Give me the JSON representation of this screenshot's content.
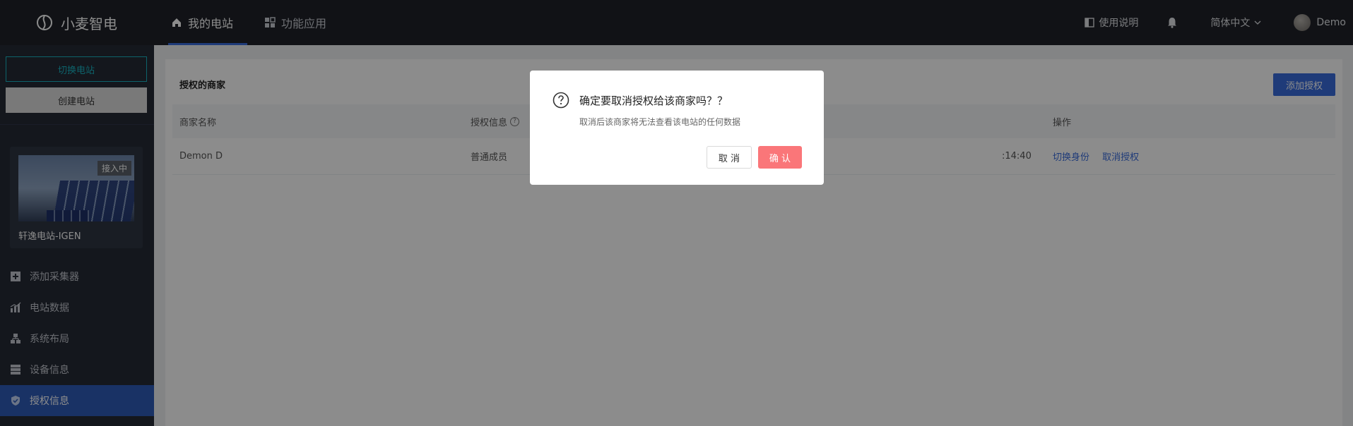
{
  "app": {
    "brand": "小麦智电",
    "colors": {
      "accent": "#3a6cdc",
      "danger": "#fa7679",
      "teal": "#19b4c4",
      "sidebar_bg": "#262b36",
      "topbar_bg": "#1f2229"
    }
  },
  "topnav": {
    "items": [
      {
        "label": "我的电站",
        "icon": "home-icon",
        "active": true
      },
      {
        "label": "功能应用",
        "icon": "apps-icon",
        "active": false
      }
    ],
    "manual": "使用说明",
    "language": "简体中文",
    "user": "Demo"
  },
  "sidebar": {
    "switch_station": "切换电站",
    "create_station": "创建电站",
    "station": {
      "status": "接入中",
      "name": "轩逸电站-IGEN"
    },
    "menu": [
      {
        "label": "添加采集器",
        "icon": "plus-square-icon",
        "active": false
      },
      {
        "label": "电站数据",
        "icon": "bar-chart-icon",
        "active": false
      },
      {
        "label": "系统布局",
        "icon": "layout-icon",
        "active": false
      },
      {
        "label": "设备信息",
        "icon": "server-icon",
        "active": false
      },
      {
        "label": "授权信息",
        "icon": "shield-icon",
        "active": true
      }
    ]
  },
  "main": {
    "title": "授权的商家",
    "add_button": "添加授权",
    "columns": [
      "商家名称",
      "授权信息",
      "",
      "操作"
    ],
    "rows": [
      {
        "merchant": "Demon D",
        "auth": "普通成员",
        "time": ":14:40",
        "actions": [
          "切换身份",
          "取消授权"
        ]
      }
    ]
  },
  "dialog": {
    "title": "确定要取消授权给该商家吗？？",
    "description": "取消后该商家将无法查看该电站的任何数据",
    "cancel": "取 消",
    "confirm": "确 认"
  }
}
